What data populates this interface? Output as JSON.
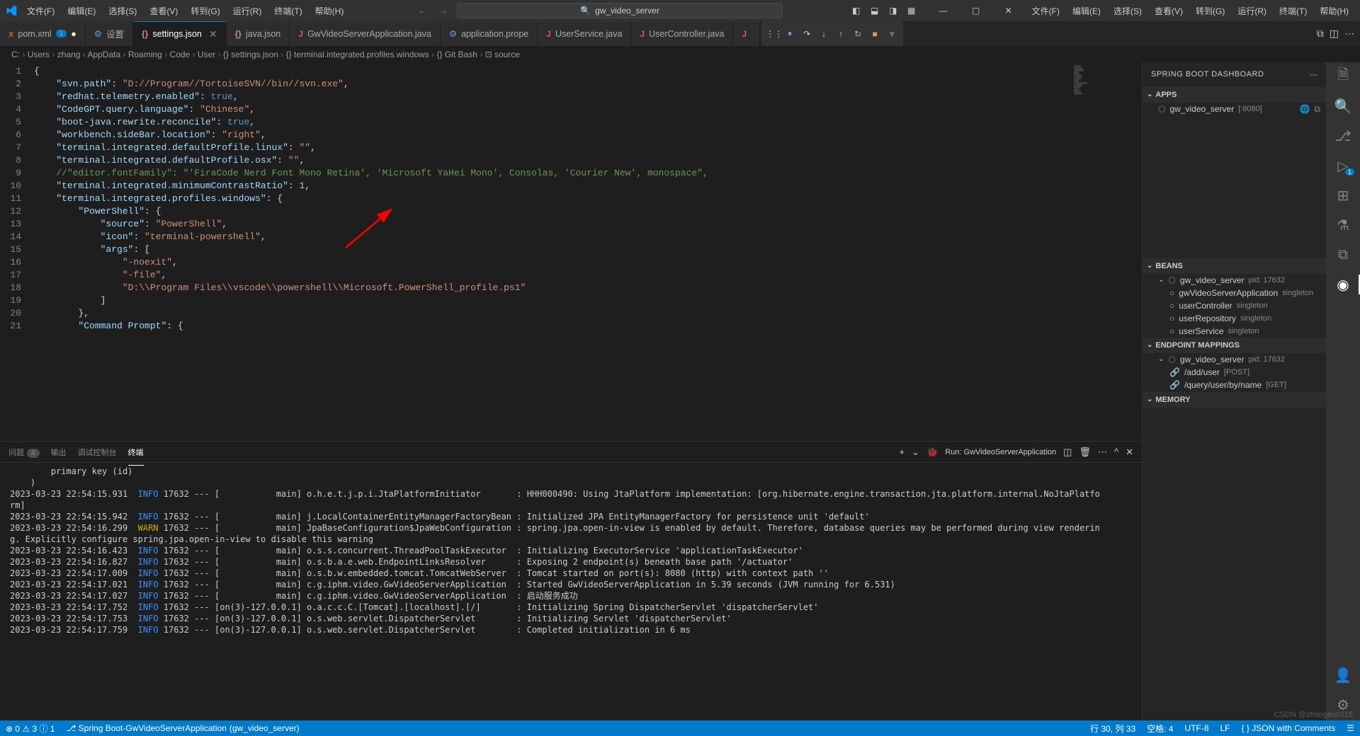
{
  "titlebar": {
    "menu": [
      "文件(F)",
      "编辑(E)",
      "选择(S)",
      "查看(V)",
      "转到(G)",
      "运行(R)",
      "终端(T)",
      "帮助(H)"
    ],
    "search_text": "gw_video_server"
  },
  "tabs": [
    {
      "icon": "xml",
      "label": "pom.xml",
      "modified": true,
      "badge": "1"
    },
    {
      "icon": "gear",
      "label": "设置"
    },
    {
      "icon": "braces",
      "label": "settings.json",
      "active": true,
      "closable": true
    },
    {
      "icon": "braces",
      "label": "java.json"
    },
    {
      "icon": "j",
      "label": "GwVideoServerApplication.java"
    },
    {
      "icon": "gear",
      "label": "application.prope"
    },
    {
      "icon": "j",
      "label": "UserService.java"
    },
    {
      "icon": "j",
      "label": "UserController.java"
    },
    {
      "icon": "j",
      "label": ""
    }
  ],
  "breadcrumbs": [
    "C:",
    "Users",
    "zhang",
    "AppData",
    "Roaming",
    "Code",
    "User",
    "{} settings.json",
    "{} terminal.integrated.profiles.windows",
    "{} Git Bash",
    "⊡ source"
  ],
  "code_lines": [
    {
      "n": 1,
      "html": "<span class='s-punc'>{</span>"
    },
    {
      "n": 2,
      "html": "    <span class='s-key'>\"svn.path\"</span><span class='s-punc'>: </span><span class='s-str'>\"D://Program//TortoiseSVN//bin//svn.exe\"</span><span class='s-punc'>,</span>"
    },
    {
      "n": 3,
      "html": "    <span class='s-key'>\"redhat.telemetry.enabled\"</span><span class='s-punc'>: </span><span class='s-bool'>true</span><span class='s-punc'>,</span>"
    },
    {
      "n": 4,
      "html": "    <span class='s-key'>\"CodeGPT.query.language\"</span><span class='s-punc'>: </span><span class='s-str'>\"Chinese\"</span><span class='s-punc'>,</span>"
    },
    {
      "n": 5,
      "html": "    <span class='s-key'>\"boot-java.rewrite.reconcile\"</span><span class='s-punc'>: </span><span class='s-bool'>true</span><span class='s-punc'>,</span>"
    },
    {
      "n": 6,
      "html": "    <span class='s-key'>\"workbench.sideBar.location\"</span><span class='s-punc'>: </span><span class='s-str'>\"right\"</span><span class='s-punc'>,</span>"
    },
    {
      "n": 7,
      "html": "    <span class='s-key'>\"terminal.integrated.defaultProfile.linux\"</span><span class='s-punc'>: </span><span class='s-str'>\"\"</span><span class='s-punc'>,</span>"
    },
    {
      "n": 8,
      "html": "    <span class='s-key'>\"terminal.integrated.defaultProfile.osx\"</span><span class='s-punc'>: </span><span class='s-str'>\"\"</span><span class='s-punc'>,</span>"
    },
    {
      "n": 9,
      "html": "    <span class='s-comment'>//\"editor.fontFamily\": \"'FiraCode Nerd Font Mono Retina', 'Microsoft YaHei Mono', Consolas, 'Courier New', monospace\",</span>"
    },
    {
      "n": 10,
      "html": "    <span class='s-key'>\"terminal.integrated.minimumContrastRatio\"</span><span class='s-punc'>: </span><span class='s-num'>1</span><span class='s-punc'>,</span>"
    },
    {
      "n": 11,
      "html": "    <span class='s-key'>\"terminal.integrated.profiles.windows\"</span><span class='s-punc'>: {</span>"
    },
    {
      "n": 12,
      "html": "        <span class='s-key'>\"PowerShell\"</span><span class='s-punc'>: {</span>"
    },
    {
      "n": 13,
      "html": "            <span class='s-key'>\"source\"</span><span class='s-punc'>: </span><span class='s-str'>\"PowerShell\"</span><span class='s-punc'>,</span>"
    },
    {
      "n": 14,
      "html": "            <span class='s-key'>\"icon\"</span><span class='s-punc'>: </span><span class='s-str'>\"terminal-powershell\"</span><span class='s-punc'>,</span>"
    },
    {
      "n": 15,
      "html": "            <span class='s-key'>\"args\"</span><span class='s-punc'>: [</span>"
    },
    {
      "n": 16,
      "html": "                <span class='s-str'>\"-noexit\"</span><span class='s-punc'>,</span>"
    },
    {
      "n": 17,
      "html": "                <span class='s-str'>\"-file\"</span><span class='s-punc'>,</span>"
    },
    {
      "n": 18,
      "html": "                <span class='s-str'>\"D:\\\\Program Files\\\\vscode\\\\powershell\\\\Microsoft.PowerShell_profile.ps1\"</span>"
    },
    {
      "n": 19,
      "html": "            <span class='s-punc'>]</span>"
    },
    {
      "n": 20,
      "html": "        <span class='s-punc'>},</span>"
    },
    {
      "n": 21,
      "html": "        <span class='s-key'>\"Command Prompt\"</span><span class='s-punc'>: {</span>"
    }
  ],
  "panel": {
    "tabs": [
      {
        "label": "问题",
        "badge": "4"
      },
      {
        "label": "输出"
      },
      {
        "label": "调试控制台"
      },
      {
        "label": "终端",
        "active": true
      }
    ],
    "run_label": "Run: GwVideoServerApplication",
    "lines": [
      "        primary key (id)",
      "    )",
      "2023-03-23 22:54:15.931  INFO 17632 --- [           main] o.h.e.t.j.p.i.JtaPlatformInitiator       : HHH000490: Using JtaPlatform implementation: [org.hibernate.engine.transaction.jta.platform.internal.NoJtaPlatfo",
      "rm]",
      "2023-03-23 22:54:15.942  INFO 17632 --- [           main] j.LocalContainerEntityManagerFactoryBean : Initialized JPA EntityManagerFactory for persistence unit 'default'",
      "2023-03-23 22:54:16.299  WARN 17632 --- [           main] JpaBaseConfiguration$JpaWebConfiguration : spring.jpa.open-in-view is enabled by default. Therefore, database queries may be performed during view renderin",
      "g. Explicitly configure spring.jpa.open-in-view to disable this warning",
      "2023-03-23 22:54:16.423  INFO 17632 --- [           main] o.s.s.concurrent.ThreadPoolTaskExecutor  : Initializing ExecutorService 'applicationTaskExecutor'",
      "2023-03-23 22:54:16.827  INFO 17632 --- [           main] o.s.b.a.e.web.EndpointLinksResolver      : Exposing 2 endpoint(s) beneath base path '/actuator'",
      "2023-03-23 22:54:17.009  INFO 17632 --- [           main] o.s.b.w.embedded.tomcat.TomcatWebServer  : Tomcat started on port(s): 8080 (http) with context path ''",
      "2023-03-23 22:54:17.021  INFO 17632 --- [           main] c.g.iphm.video.GwVideoServerApplication  : Started GwVideoServerApplication in 5.39 seconds (JVM running for 6.531)",
      "2023-03-23 22:54:17.027  INFO 17632 --- [           main] c.g.iphm.video.GwVideoServerApplication  : 启动服务成功",
      "2023-03-23 22:54:17.752  INFO 17632 --- [on(3)-127.0.0.1] o.a.c.c.C.[Tomcat].[localhost].[/]       : Initializing Spring DispatcherServlet 'dispatcherServlet'",
      "2023-03-23 22:54:17.753  INFO 17632 --- [on(3)-127.0.0.1] o.s.web.servlet.DispatcherServlet        : Initializing Servlet 'dispatcherServlet'",
      "2023-03-23 22:54:17.759  INFO 17632 --- [on(3)-127.0.0.1] o.s.web.servlet.DispatcherServlet        : Completed initialization in 6 ms"
    ]
  },
  "dashboard": {
    "title": "SPRING BOOT DASHBOARD",
    "apps": {
      "header": "APPS",
      "items": [
        {
          "name": "gw_video_server",
          "port": "[:8080]"
        }
      ]
    },
    "beans": {
      "header": "BEANS",
      "root": "gw_video_server",
      "root_pid": "pid: 17632",
      "items": [
        {
          "name": "gwVideoServerApplication",
          "scope": "singleton"
        },
        {
          "name": "userController",
          "scope": "singleton"
        },
        {
          "name": "userRepository",
          "scope": "singleton"
        },
        {
          "name": "userService",
          "scope": "singleton"
        }
      ]
    },
    "endpoints": {
      "header": "ENDPOINT MAPPINGS",
      "root": "gw_video_server",
      "root_pid": "pid: 17632",
      "items": [
        {
          "path": "/add/user",
          "method": "[POST]"
        },
        {
          "path": "/query/user/by/name",
          "method": "[GET]"
        }
      ]
    },
    "memory": {
      "header": "MEMORY"
    }
  },
  "statusbar": {
    "left": [
      "⊗ 0 ⚠ 3 ⓘ 1",
      "⎇ Spring Boot-GwVideoServerApplication<gw_video_server> (gw_video_server)"
    ],
    "right": [
      "行 30, 列 33",
      "空格: 4",
      "UTF-8",
      "LF",
      "{ } JSON with Comments",
      "☰"
    ]
  },
  "watermark": "CSDN @zhangbo0115"
}
